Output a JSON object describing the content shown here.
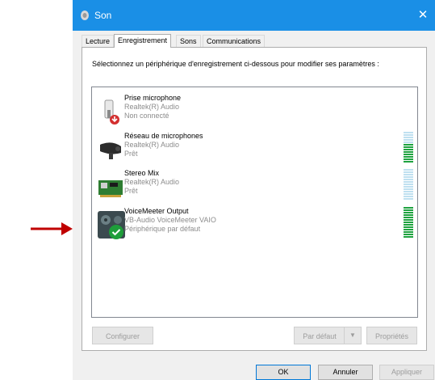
{
  "window": {
    "title": "Son",
    "close_glyph": "✕",
    "title_bar_color": "#1a8fe6"
  },
  "tabs": [
    {
      "label": "Lecture"
    },
    {
      "label": "Enregistrement"
    },
    {
      "label": "Sons"
    },
    {
      "label": "Communications"
    }
  ],
  "instruction": "Sélectionnez un périphérique d'enregistrement ci-dessous pour modifier ses paramètres :",
  "devices": [
    {
      "name": "Prise microphone",
      "driver": "Realtek(R) Audio",
      "status": "Non connecté",
      "icon": "microphone-jack-disconnected-icon",
      "level": null
    },
    {
      "name": "Réseau de microphones",
      "driver": "Realtek(R) Audio",
      "status": "Prêt",
      "icon": "webcam-microphone-icon",
      "level": 0.65
    },
    {
      "name": "Stereo Mix",
      "driver": "Realtek(R) Audio",
      "status": "Prêt",
      "icon": "sound-card-icon",
      "level": 0
    },
    {
      "name": "VoiceMeeter Output",
      "driver": "VB-Audio VoiceMeeter VAIO",
      "status": "Périphérique par défaut",
      "icon": "voicemeeter-default-device-icon",
      "level": 1.0
    }
  ],
  "buttons": {
    "configure": "Configurer",
    "set_default": "Par défaut",
    "set_default_arrow": "▼",
    "properties": "Propriétés",
    "ok": "OK",
    "cancel": "Annuler",
    "apply": "Appliquer"
  },
  "colors": {
    "meter_active": "#1fa340",
    "meter_inactive": "#bfe0f0",
    "arrow": "#c00000",
    "default_check": "#1e9e3a",
    "disconnected_badge": "#d32f2f"
  }
}
